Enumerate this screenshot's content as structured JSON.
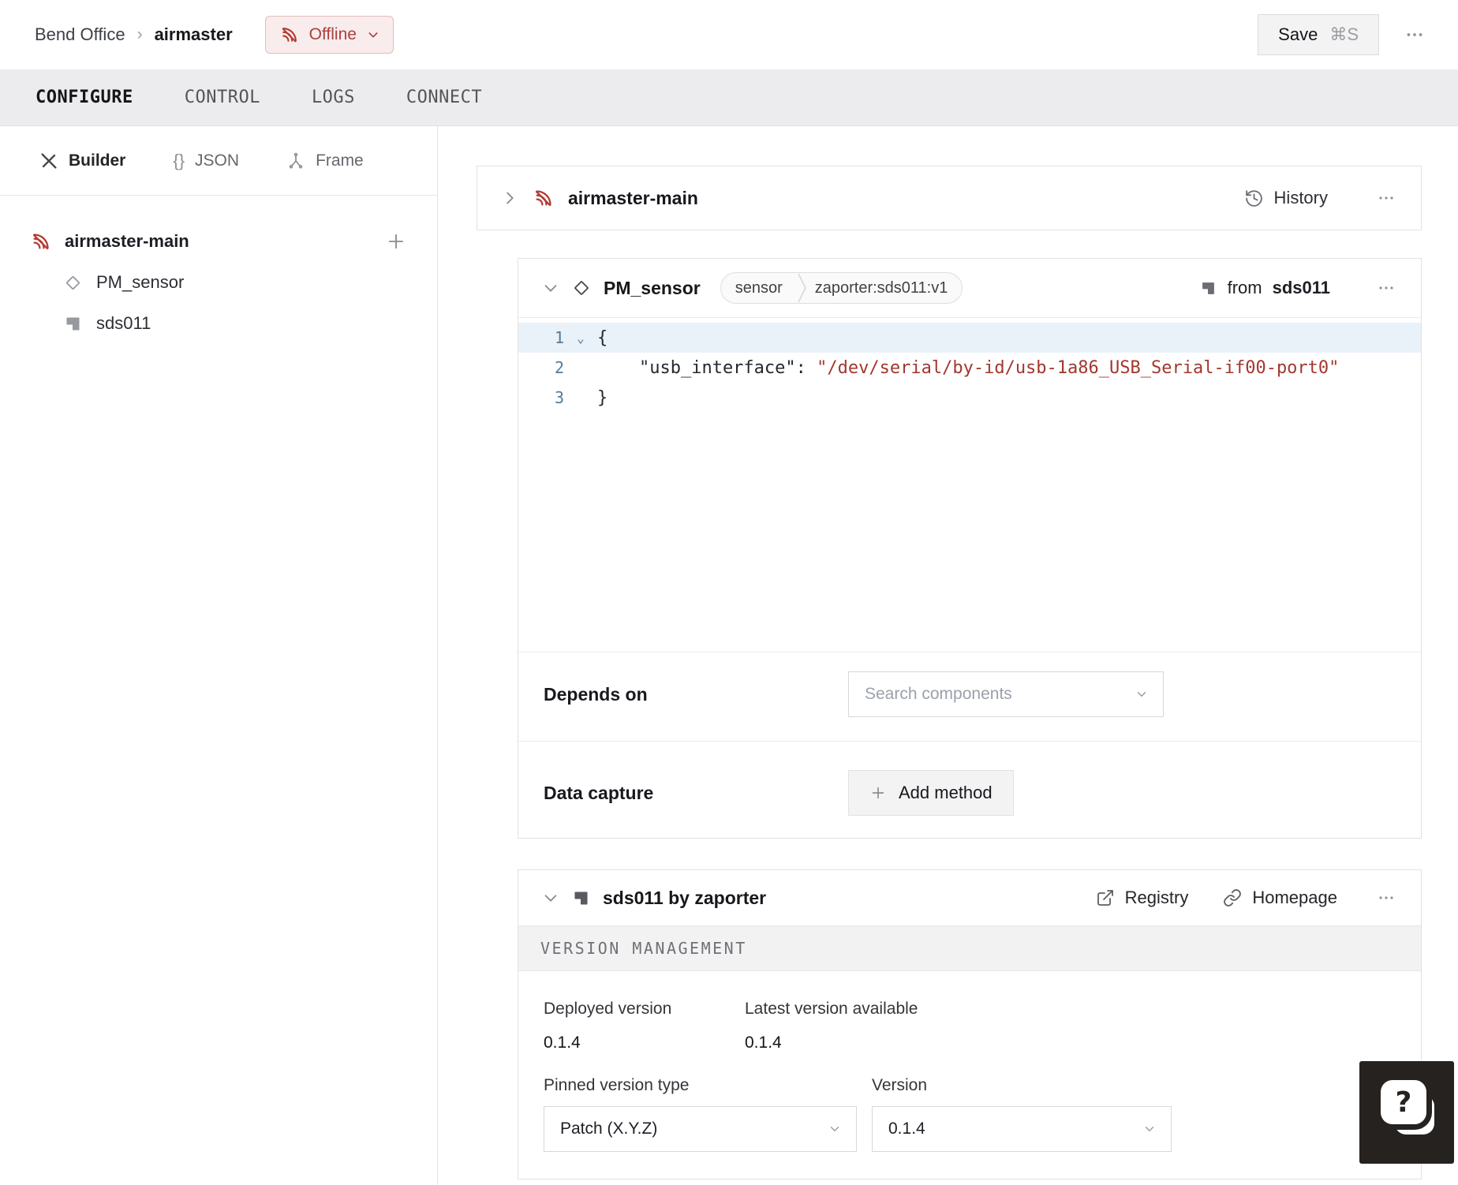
{
  "topbar": {
    "breadcrumb": {
      "location": "Bend Office",
      "separator": "›",
      "machine": "airmaster"
    },
    "status": {
      "label": "Offline"
    },
    "save": {
      "label": "Save",
      "shortcut": "⌘S"
    }
  },
  "tabs": [
    {
      "label": "CONFIGURE",
      "active": true
    },
    {
      "label": "CONTROL",
      "active": false
    },
    {
      "label": "LOGS",
      "active": false
    },
    {
      "label": "CONNECT",
      "active": false
    }
  ],
  "sidebar": {
    "modes": [
      {
        "label": "Builder",
        "icon": "tools-icon",
        "active": true
      },
      {
        "label": "JSON",
        "icon": "braces-icon",
        "active": false
      },
      {
        "label": "Frame",
        "icon": "frame-axes-icon",
        "active": false
      }
    ],
    "tree": {
      "root": {
        "label": "airmaster-main",
        "status_icon": "wifi-off-icon"
      },
      "children": [
        {
          "label": "PM_sensor",
          "icon": "diamond-icon"
        },
        {
          "label": "sds011",
          "icon": "module-icon"
        }
      ]
    }
  },
  "main": {
    "machine_card": {
      "title": "airmaster-main",
      "history_label": "History"
    },
    "component_card": {
      "title": "PM_sensor",
      "type_badge": "sensor",
      "model_badge": "zaporter:sds011:v1",
      "from_prefix": "from",
      "from_module": "sds011",
      "code": {
        "line_numbers": [
          "1",
          "2",
          "3"
        ],
        "line1": "{",
        "line2_key": "    \"usb_interface\": ",
        "line2_value": "\"/dev/serial/by-id/usb-1a86_USB_Serial-if00-port0\"",
        "line3": "}"
      },
      "depends_on": {
        "label": "Depends on",
        "placeholder": "Search components"
      },
      "data_capture": {
        "label": "Data capture",
        "add_button": "Add method"
      }
    },
    "module_card": {
      "title": "sds011 by zaporter",
      "registry_label": "Registry",
      "homepage_label": "Homepage",
      "section_title": "VERSION MANAGEMENT",
      "deployed": {
        "label": "Deployed version",
        "value": "0.1.4"
      },
      "latest": {
        "label": "Latest version available",
        "value": "0.1.4"
      },
      "pinned_type": {
        "label": "Pinned version type",
        "value": "Patch (X.Y.Z)"
      },
      "version": {
        "label": "Version",
        "value": "0.1.4"
      }
    }
  },
  "colors": {
    "offline_red_icon": "#b23a33",
    "offline_badge_bg": "#f9ecec",
    "offline_badge_border": "#e5bcbc",
    "offline_badge_text": "#a84040",
    "code_string": "#a3372e",
    "code_active_line_bg": "#e9f1f9",
    "line_number": "#527b97",
    "tabbar_bg": "#ececee",
    "help_fab_bg": "#262220"
  }
}
